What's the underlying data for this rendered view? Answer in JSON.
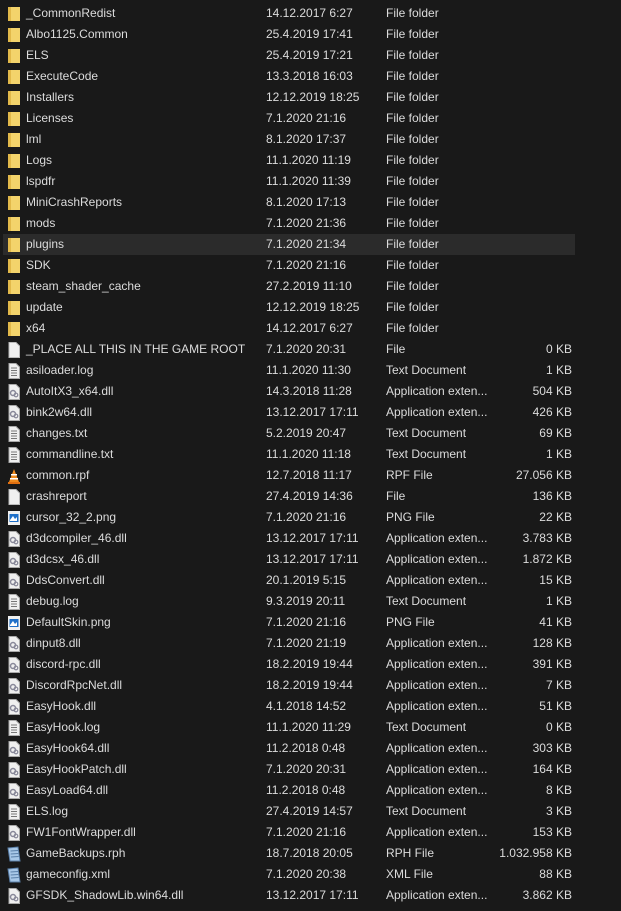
{
  "accent_colors": {
    "folder": "#f3d36b",
    "selected_row": "#2b2b2b",
    "background": "#191919"
  },
  "files": [
    {
      "name": "_CommonRedist",
      "date": "14.12.2017 6:27",
      "type": "File folder",
      "size": "",
      "icon": "folder"
    },
    {
      "name": "Albo1125.Common",
      "date": "25.4.2019 17:41",
      "type": "File folder",
      "size": "",
      "icon": "folder"
    },
    {
      "name": "ELS",
      "date": "25.4.2019 17:21",
      "type": "File folder",
      "size": "",
      "icon": "folder"
    },
    {
      "name": "ExecuteCode",
      "date": "13.3.2018 16:03",
      "type": "File folder",
      "size": "",
      "icon": "folder"
    },
    {
      "name": "Installers",
      "date": "12.12.2019 18:25",
      "type": "File folder",
      "size": "",
      "icon": "folder"
    },
    {
      "name": "Licenses",
      "date": "7.1.2020 21:16",
      "type": "File folder",
      "size": "",
      "icon": "folder"
    },
    {
      "name": "lml",
      "date": "8.1.2020 17:37",
      "type": "File folder",
      "size": "",
      "icon": "folder"
    },
    {
      "name": "Logs",
      "date": "11.1.2020 11:19",
      "type": "File folder",
      "size": "",
      "icon": "folder"
    },
    {
      "name": "lspdfr",
      "date": "11.1.2020 11:39",
      "type": "File folder",
      "size": "",
      "icon": "folder"
    },
    {
      "name": "MiniCrashReports",
      "date": "8.1.2020 17:13",
      "type": "File folder",
      "size": "",
      "icon": "folder"
    },
    {
      "name": "mods",
      "date": "7.1.2020 21:36",
      "type": "File folder",
      "size": "",
      "icon": "folder"
    },
    {
      "name": "plugins",
      "date": "7.1.2020 21:34",
      "type": "File folder",
      "size": "",
      "icon": "folder",
      "selected": true
    },
    {
      "name": "SDK",
      "date": "7.1.2020 21:16",
      "type": "File folder",
      "size": "",
      "icon": "folder"
    },
    {
      "name": "steam_shader_cache",
      "date": "27.2.2019 11:10",
      "type": "File folder",
      "size": "",
      "icon": "folder"
    },
    {
      "name": "update",
      "date": "12.12.2019 18:25",
      "type": "File folder",
      "size": "",
      "icon": "folder"
    },
    {
      "name": "x64",
      "date": "14.12.2017 6:27",
      "type": "File folder",
      "size": "",
      "icon": "folder"
    },
    {
      "name": "_PLACE ALL THIS IN THE GAME ROOT",
      "date": "7.1.2020 20:31",
      "type": "File",
      "size": "0 KB",
      "icon": "file"
    },
    {
      "name": "asiloader.log",
      "date": "11.1.2020 11:30",
      "type": "Text Document",
      "size": "1 KB",
      "icon": "text"
    },
    {
      "name": "AutoItX3_x64.dll",
      "date": "14.3.2018 11:28",
      "type": "Application exten...",
      "size": "504 KB",
      "icon": "dll"
    },
    {
      "name": "bink2w64.dll",
      "date": "13.12.2017 17:11",
      "type": "Application exten...",
      "size": "426 KB",
      "icon": "dll"
    },
    {
      "name": "changes.txt",
      "date": "5.2.2019 20:47",
      "type": "Text Document",
      "size": "69 KB",
      "icon": "text"
    },
    {
      "name": "commandline.txt",
      "date": "11.1.2020 11:18",
      "type": "Text Document",
      "size": "1 KB",
      "icon": "text"
    },
    {
      "name": "common.rpf",
      "date": "12.7.2018 11:17",
      "type": "RPF File",
      "size": "27.056 KB",
      "icon": "vlc"
    },
    {
      "name": "crashreport",
      "date": "27.4.2019 14:36",
      "type": "File",
      "size": "136 KB",
      "icon": "file"
    },
    {
      "name": "cursor_32_2.png",
      "date": "7.1.2020 21:16",
      "type": "PNG File",
      "size": "22 KB",
      "icon": "image"
    },
    {
      "name": "d3dcompiler_46.dll",
      "date": "13.12.2017 17:11",
      "type": "Application exten...",
      "size": "3.783 KB",
      "icon": "dll"
    },
    {
      "name": "d3dcsx_46.dll",
      "date": "13.12.2017 17:11",
      "type": "Application exten...",
      "size": "1.872 KB",
      "icon": "dll"
    },
    {
      "name": "DdsConvert.dll",
      "date": "20.1.2019 5:15",
      "type": "Application exten...",
      "size": "15 KB",
      "icon": "dll"
    },
    {
      "name": "debug.log",
      "date": "9.3.2019 20:11",
      "type": "Text Document",
      "size": "1 KB",
      "icon": "text"
    },
    {
      "name": "DefaultSkin.png",
      "date": "7.1.2020 21:16",
      "type": "PNG File",
      "size": "41 KB",
      "icon": "image"
    },
    {
      "name": "dinput8.dll",
      "date": "7.1.2020 21:19",
      "type": "Application exten...",
      "size": "128 KB",
      "icon": "dll"
    },
    {
      "name": "discord-rpc.dll",
      "date": "18.2.2019 19:44",
      "type": "Application exten...",
      "size": "391 KB",
      "icon": "dll"
    },
    {
      "name": "DiscordRpcNet.dll",
      "date": "18.2.2019 19:44",
      "type": "Application exten...",
      "size": "7 KB",
      "icon": "dll"
    },
    {
      "name": "EasyHook.dll",
      "date": "4.1.2018 14:52",
      "type": "Application exten...",
      "size": "51 KB",
      "icon": "dll"
    },
    {
      "name": "EasyHook.log",
      "date": "11.1.2020 11:29",
      "type": "Text Document",
      "size": "0 KB",
      "icon": "text"
    },
    {
      "name": "EasyHook64.dll",
      "date": "11.2.2018 0:48",
      "type": "Application exten...",
      "size": "303 KB",
      "icon": "dll"
    },
    {
      "name": "EasyHookPatch.dll",
      "date": "7.1.2020 20:31",
      "type": "Application exten...",
      "size": "164 KB",
      "icon": "dll"
    },
    {
      "name": "EasyLoad64.dll",
      "date": "11.2.2018 0:48",
      "type": "Application exten...",
      "size": "8 KB",
      "icon": "dll"
    },
    {
      "name": "ELS.log",
      "date": "27.4.2019 14:57",
      "type": "Text Document",
      "size": "3 KB",
      "icon": "text"
    },
    {
      "name": "FW1FontWrapper.dll",
      "date": "7.1.2020 21:16",
      "type": "Application exten...",
      "size": "153 KB",
      "icon": "dll"
    },
    {
      "name": "GameBackups.rph",
      "date": "18.7.2018 20:05",
      "type": "RPH File",
      "size": "1.032.958 KB",
      "icon": "notepad"
    },
    {
      "name": "gameconfig.xml",
      "date": "7.1.2020 20:38",
      "type": "XML File",
      "size": "88 KB",
      "icon": "notepad"
    },
    {
      "name": "GFSDK_ShadowLib.win64.dll",
      "date": "13.12.2017 17:11",
      "type": "Application exten...",
      "size": "3.862 KB",
      "icon": "dll"
    }
  ]
}
